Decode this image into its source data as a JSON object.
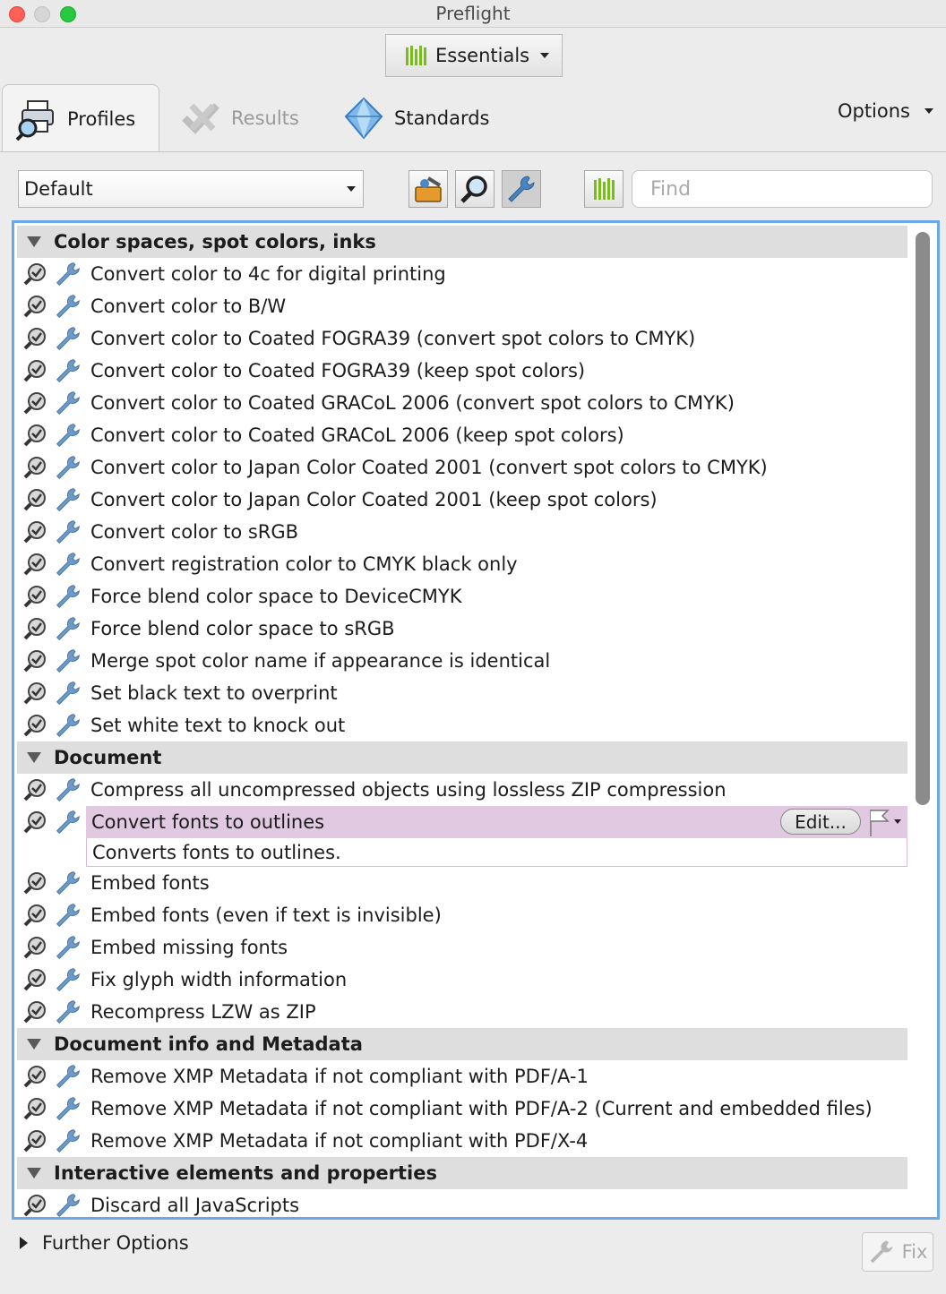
{
  "window": {
    "title": "Preflight"
  },
  "workspace": {
    "label": "Essentials"
  },
  "tabs": [
    {
      "label": "Profiles",
      "icon": "printer-magnifier-icon",
      "active": true
    },
    {
      "label": "Results",
      "icon": "results-icon",
      "active": false
    },
    {
      "label": "Standards",
      "icon": "standards-diamond-icon",
      "active": false
    }
  ],
  "options_label": "Options",
  "toolbar": {
    "profile_select": "Default",
    "find_placeholder": "Find"
  },
  "groups": [
    {
      "title": "Color spaces, spot colors, inks",
      "items": [
        "Convert color to 4c for digital printing",
        "Convert color to B/W",
        "Convert color to Coated FOGRA39 (convert spot colors to CMYK)",
        "Convert color to Coated FOGRA39 (keep spot colors)",
        "Convert color to Coated GRACoL 2006 (convert spot colors to CMYK)",
        "Convert color to Coated GRACoL 2006 (keep spot colors)",
        "Convert color to Japan Color Coated 2001 (convert spot colors to CMYK)",
        "Convert color to Japan Color Coated 2001 (keep spot colors)",
        "Convert color to sRGB",
        "Convert registration color to CMYK black only",
        "Force blend color space to DeviceCMYK",
        "Force blend color space to sRGB",
        "Merge spot color name if appearance is identical",
        "Set black text to overprint",
        "Set white text to knock out"
      ]
    },
    {
      "title": "Document",
      "items": [
        "Compress all uncompressed objects using lossless ZIP compression",
        "Convert fonts to outlines",
        "Embed fonts",
        "Embed fonts (even if text is invisible)",
        "Embed missing fonts",
        "Fix glyph width information",
        "Recompress LZW as ZIP"
      ]
    },
    {
      "title": "Document info and Metadata",
      "items": [
        "Remove XMP Metadata if not compliant with PDF/A-1",
        "Remove XMP Metadata if not compliant with PDF/A-2 (Current and embedded files)",
        "Remove XMP Metadata if not compliant with PDF/X-4"
      ]
    },
    {
      "title": "Interactive elements and properties",
      "items": [
        "Discard all JavaScripts"
      ]
    }
  ],
  "selected": {
    "edit_label": "Edit...",
    "description": "Converts fonts to outlines."
  },
  "footer": {
    "further_options": "Further Options",
    "fix_label": "Fix"
  },
  "colors": {
    "selection": "#e2c9e2",
    "focus_ring": "#6ea7e6",
    "accent_green": "#7bbd17"
  }
}
